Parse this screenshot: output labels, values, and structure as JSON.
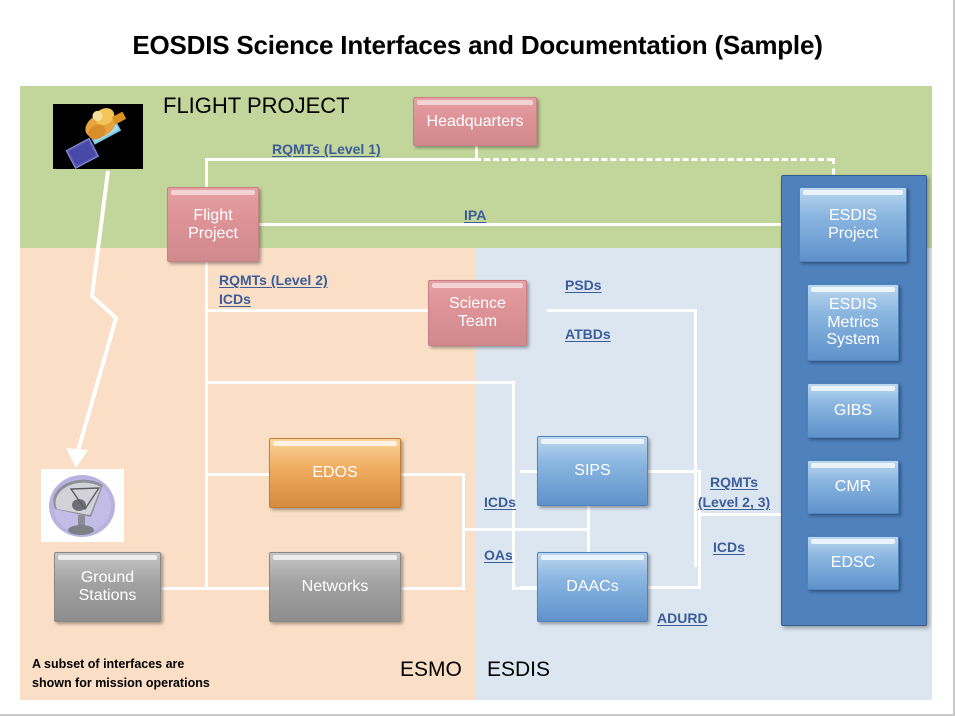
{
  "title": "EOSDIS Science Interfaces and Documentation (Sample)",
  "regions": {
    "flight_project": "FLIGHT PROJECT",
    "esmo": "ESMO",
    "esdis": "ESDIS"
  },
  "footnote": {
    "line1": "A subset of interfaces are",
    "line2": "shown for mission operations"
  },
  "nodes": {
    "headquarters": "Headquarters",
    "flight_project": "Flight\nProject",
    "flight_project_l1": "Flight",
    "flight_project_l2": "Project",
    "science_team_l1": "Science",
    "science_team_l2": "Team",
    "edos": "EDOS",
    "networks": "Networks",
    "ground_stations_l1": "Ground",
    "ground_stations_l2": "Stations",
    "sips": "SIPS",
    "daacs": "DAACs",
    "esdis_project_l1": "ESDIS",
    "esdis_project_l2": "Project",
    "esdis_metrics_l1": "ESDIS",
    "esdis_metrics_l2": "Metrics",
    "esdis_metrics_l3": "System",
    "gibs": "GIBS",
    "cmr": "CMR",
    "edsc": "EDSC"
  },
  "doc_labels": {
    "rqmts_level1": "RQMTs (Level 1)",
    "ipa": "IPA",
    "rqmts_level2": "RQMTs (Level 2)",
    "icds_left": "ICDs",
    "psds": "PSDs",
    "atbds": "ATBDs",
    "icds_mid": "ICDs",
    "oas": "OAs",
    "rqmts_level23_l1": "RQMTs",
    "rqmts_level23_l2": "(Level 2, 3)",
    "icds_right": "ICDs",
    "adurd": "ADURD"
  },
  "colors": {
    "band_green": "#c2d69b",
    "band_peach": "#fadfc6",
    "band_blue": "#dce6f1",
    "pink_node": "#dd9296",
    "blue_node": "#8ab6e0",
    "orange_node": "#efab5e",
    "gray_node": "#a2a2a2",
    "esdis_container": "#4f81bd",
    "doc_label": "#3b5d99",
    "connector": "#ffffff"
  },
  "icons": {
    "satellite": "satellite-image",
    "ground_dish": "satellite-dish-image"
  }
}
